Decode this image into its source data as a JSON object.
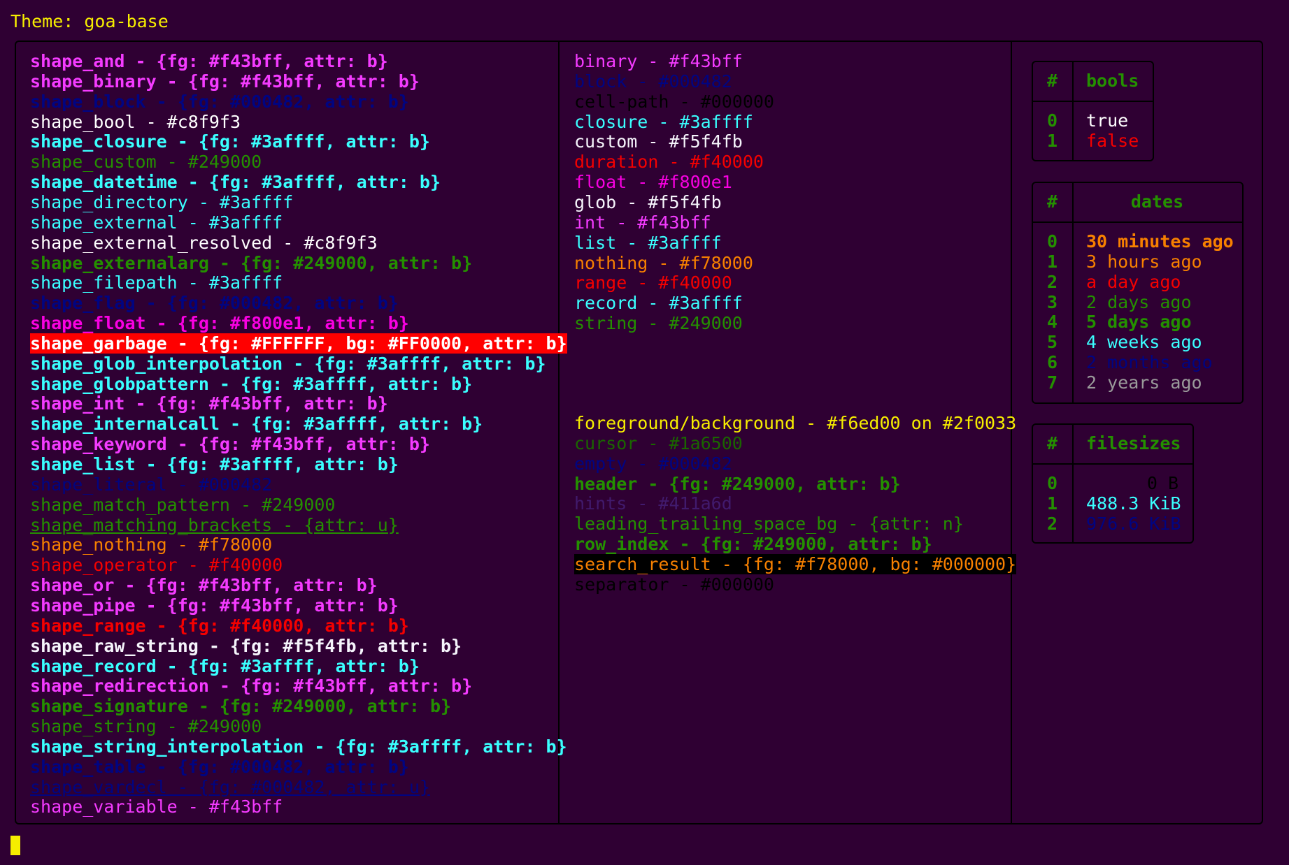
{
  "title": "Theme: goa-base",
  "colors": {
    "background": "#2f0033",
    "title": "#f6ed00",
    "border": "#000000",
    "cursor": "#f6ed00"
  },
  "left_column": [
    {
      "text": "shape_and - {fg: #f43bff, attr: b}",
      "color": "#f43bff",
      "bold": true
    },
    {
      "text": "shape_binary - {fg: #f43bff, attr: b}",
      "color": "#f43bff",
      "bold": true
    },
    {
      "text": "shape_block - {fg: #000482, attr: b}",
      "color": "#000482",
      "bold": true
    },
    {
      "text": "shape_bool - #c8f9f3",
      "color": "#ffffff"
    },
    {
      "text": "shape_closure - {fg: #3affff, attr: b}",
      "color": "#3affff",
      "bold": true
    },
    {
      "text": "shape_custom - #249000",
      "color": "#249000"
    },
    {
      "text": "shape_datetime - {fg: #3affff, attr: b}",
      "color": "#3affff",
      "bold": true
    },
    {
      "text": "shape_directory - #3affff",
      "color": "#3affff"
    },
    {
      "text": "shape_external - #3affff",
      "color": "#3affff"
    },
    {
      "text": "shape_external_resolved - #c8f9f3",
      "color": "#ffffff"
    },
    {
      "text": "shape_externalarg - {fg: #249000, attr: b}",
      "color": "#249000",
      "bold": true
    },
    {
      "text": "shape_filepath - #3affff",
      "color": "#3affff"
    },
    {
      "text": "shape_flag - {fg: #000482, attr: b}",
      "color": "#000482",
      "bold": true
    },
    {
      "text": "shape_float - {fg: #f800e1, attr: b}",
      "color": "#f800e1",
      "bold": true
    },
    {
      "text": "shape_garbage - {fg: #FFFFFF, bg: #FF0000, attr: b}",
      "color": "#ffffff",
      "bg": "#ff0000",
      "bold": true
    },
    {
      "text": "shape_glob_interpolation - {fg: #3affff, attr: b}",
      "color": "#3affff",
      "bold": true
    },
    {
      "text": "shape_globpattern - {fg: #3affff, attr: b}",
      "color": "#3affff",
      "bold": true
    },
    {
      "text": "shape_int - {fg: #f43bff, attr: b}",
      "color": "#f43bff",
      "bold": true
    },
    {
      "text": "shape_internalcall - {fg: #3affff, attr: b}",
      "color": "#3affff",
      "bold": true
    },
    {
      "text": "shape_keyword - {fg: #f43bff, attr: b}",
      "color": "#f43bff",
      "bold": true
    },
    {
      "text": "shape_list - {fg: #3affff, attr: b}",
      "color": "#3affff",
      "bold": true
    },
    {
      "text": "shape_literal - #000482",
      "color": "#000482"
    },
    {
      "text": "shape_match_pattern - #249000",
      "color": "#249000"
    },
    {
      "text": "shape_matching_brackets - {attr: u}",
      "color": "#249000",
      "underline": true
    },
    {
      "text": "shape_nothing - #f78000",
      "color": "#f78000"
    },
    {
      "text": "shape_operator - #f40000",
      "color": "#f40000"
    },
    {
      "text": "shape_or - {fg: #f43bff, attr: b}",
      "color": "#f43bff",
      "bold": true
    },
    {
      "text": "shape_pipe - {fg: #f43bff, attr: b}",
      "color": "#f43bff",
      "bold": true
    },
    {
      "text": "shape_range - {fg: #f40000, attr: b}",
      "color": "#f40000",
      "bold": true
    },
    {
      "text": "shape_raw_string - {fg: #f5f4fb, attr: b}",
      "color": "#f5f4fb",
      "bold": true
    },
    {
      "text": "shape_record - {fg: #3affff, attr: b}",
      "color": "#3affff",
      "bold": true
    },
    {
      "text": "shape_redirection - {fg: #f43bff, attr: b}",
      "color": "#f43bff",
      "bold": true
    },
    {
      "text": "shape_signature - {fg: #249000, attr: b}",
      "color": "#249000",
      "bold": true
    },
    {
      "text": "shape_string - #249000",
      "color": "#249000"
    },
    {
      "text": "shape_string_interpolation - {fg: #3affff, attr: b}",
      "color": "#3affff",
      "bold": true
    },
    {
      "text": "shape_table - {fg: #000482, attr: b}",
      "color": "#000482",
      "bold": true
    },
    {
      "text": "shape_vardecl - {fg: #000482, attr: u}",
      "color": "#000482",
      "underline": true
    },
    {
      "text": "shape_variable - #f43bff",
      "color": "#f43bff"
    }
  ],
  "middle_column_types": [
    {
      "text": "binary - #f43bff",
      "color": "#f43bff"
    },
    {
      "text": "block - #000482",
      "color": "#000482"
    },
    {
      "text": "cell-path - #000000",
      "color": "#000000"
    },
    {
      "text": "closure - #3affff",
      "color": "#3affff"
    },
    {
      "text": "custom - #f5f4fb",
      "color": "#f5f4fb"
    },
    {
      "text": "duration - #f40000",
      "color": "#f40000"
    },
    {
      "text": "float - #f800e1",
      "color": "#f800e1"
    },
    {
      "text": "glob - #f5f4fb",
      "color": "#f5f4fb"
    },
    {
      "text": "int - #f43bff",
      "color": "#f43bff"
    },
    {
      "text": "list - #3affff",
      "color": "#3affff"
    },
    {
      "text": "nothing - #f78000",
      "color": "#f78000"
    },
    {
      "text": "range - #f40000",
      "color": "#f40000"
    },
    {
      "text": "record - #3affff",
      "color": "#3affff"
    },
    {
      "text": "string - #249000",
      "color": "#249000"
    }
  ],
  "middle_column_ui": [
    {
      "text": "foreground/background - #f6ed00 on #2f0033",
      "color": "#f6ed00"
    },
    {
      "text": "cursor - #1a6500",
      "color": "#1a6500"
    },
    {
      "text": "empty - #000482",
      "color": "#000482"
    },
    {
      "text": "header - {fg: #249000, attr: b}",
      "color": "#249000",
      "bold": true
    },
    {
      "text": "hints - #411a6d",
      "color": "#411a6d"
    },
    {
      "text": "leading_trailing_space_bg - {attr: n}",
      "color": "#249000"
    },
    {
      "text": "row_index - {fg: #249000, attr: b}",
      "color": "#249000",
      "bold": true
    },
    {
      "text": "search_result - {fg: #f78000, bg: #000000}",
      "color": "#f78000",
      "bg": "#000000"
    },
    {
      "text": "separator - #000000",
      "color": "#000000"
    }
  ],
  "bools_table": {
    "index_header": "#",
    "header": "bools",
    "rows": [
      {
        "index": "0",
        "value": "true",
        "color": "#ffffff"
      },
      {
        "index": "1",
        "value": "false",
        "color": "#f40000"
      }
    ]
  },
  "dates_table": {
    "index_header": "#",
    "header": "dates",
    "rows": [
      {
        "index": "0",
        "value": "30 minutes ago",
        "color": "#f78000",
        "bold": true
      },
      {
        "index": "1",
        "value": "3 hours ago",
        "color": "#f78000"
      },
      {
        "index": "2",
        "value": "a day ago",
        "color": "#f40000"
      },
      {
        "index": "3",
        "value": "2 days ago",
        "color": "#249000"
      },
      {
        "index": "4",
        "value": "5 days ago",
        "color": "#249000",
        "bold": true
      },
      {
        "index": "5",
        "value": "4 weeks ago",
        "color": "#3affff"
      },
      {
        "index": "6",
        "value": "2 months ago",
        "color": "#000482"
      },
      {
        "index": "7",
        "value": "2 years ago",
        "color": "#9a9a9a"
      }
    ]
  },
  "filesizes_table": {
    "index_header": "#",
    "header": "filesizes",
    "rows": [
      {
        "index": "0",
        "value": "0 B",
        "color": "#000000",
        "align": "right"
      },
      {
        "index": "1",
        "value": "488.3 KiB",
        "color": "#3affff",
        "align": "left"
      },
      {
        "index": "2",
        "value": "976.6 KiB",
        "color": "#000482",
        "align": "left"
      }
    ]
  }
}
